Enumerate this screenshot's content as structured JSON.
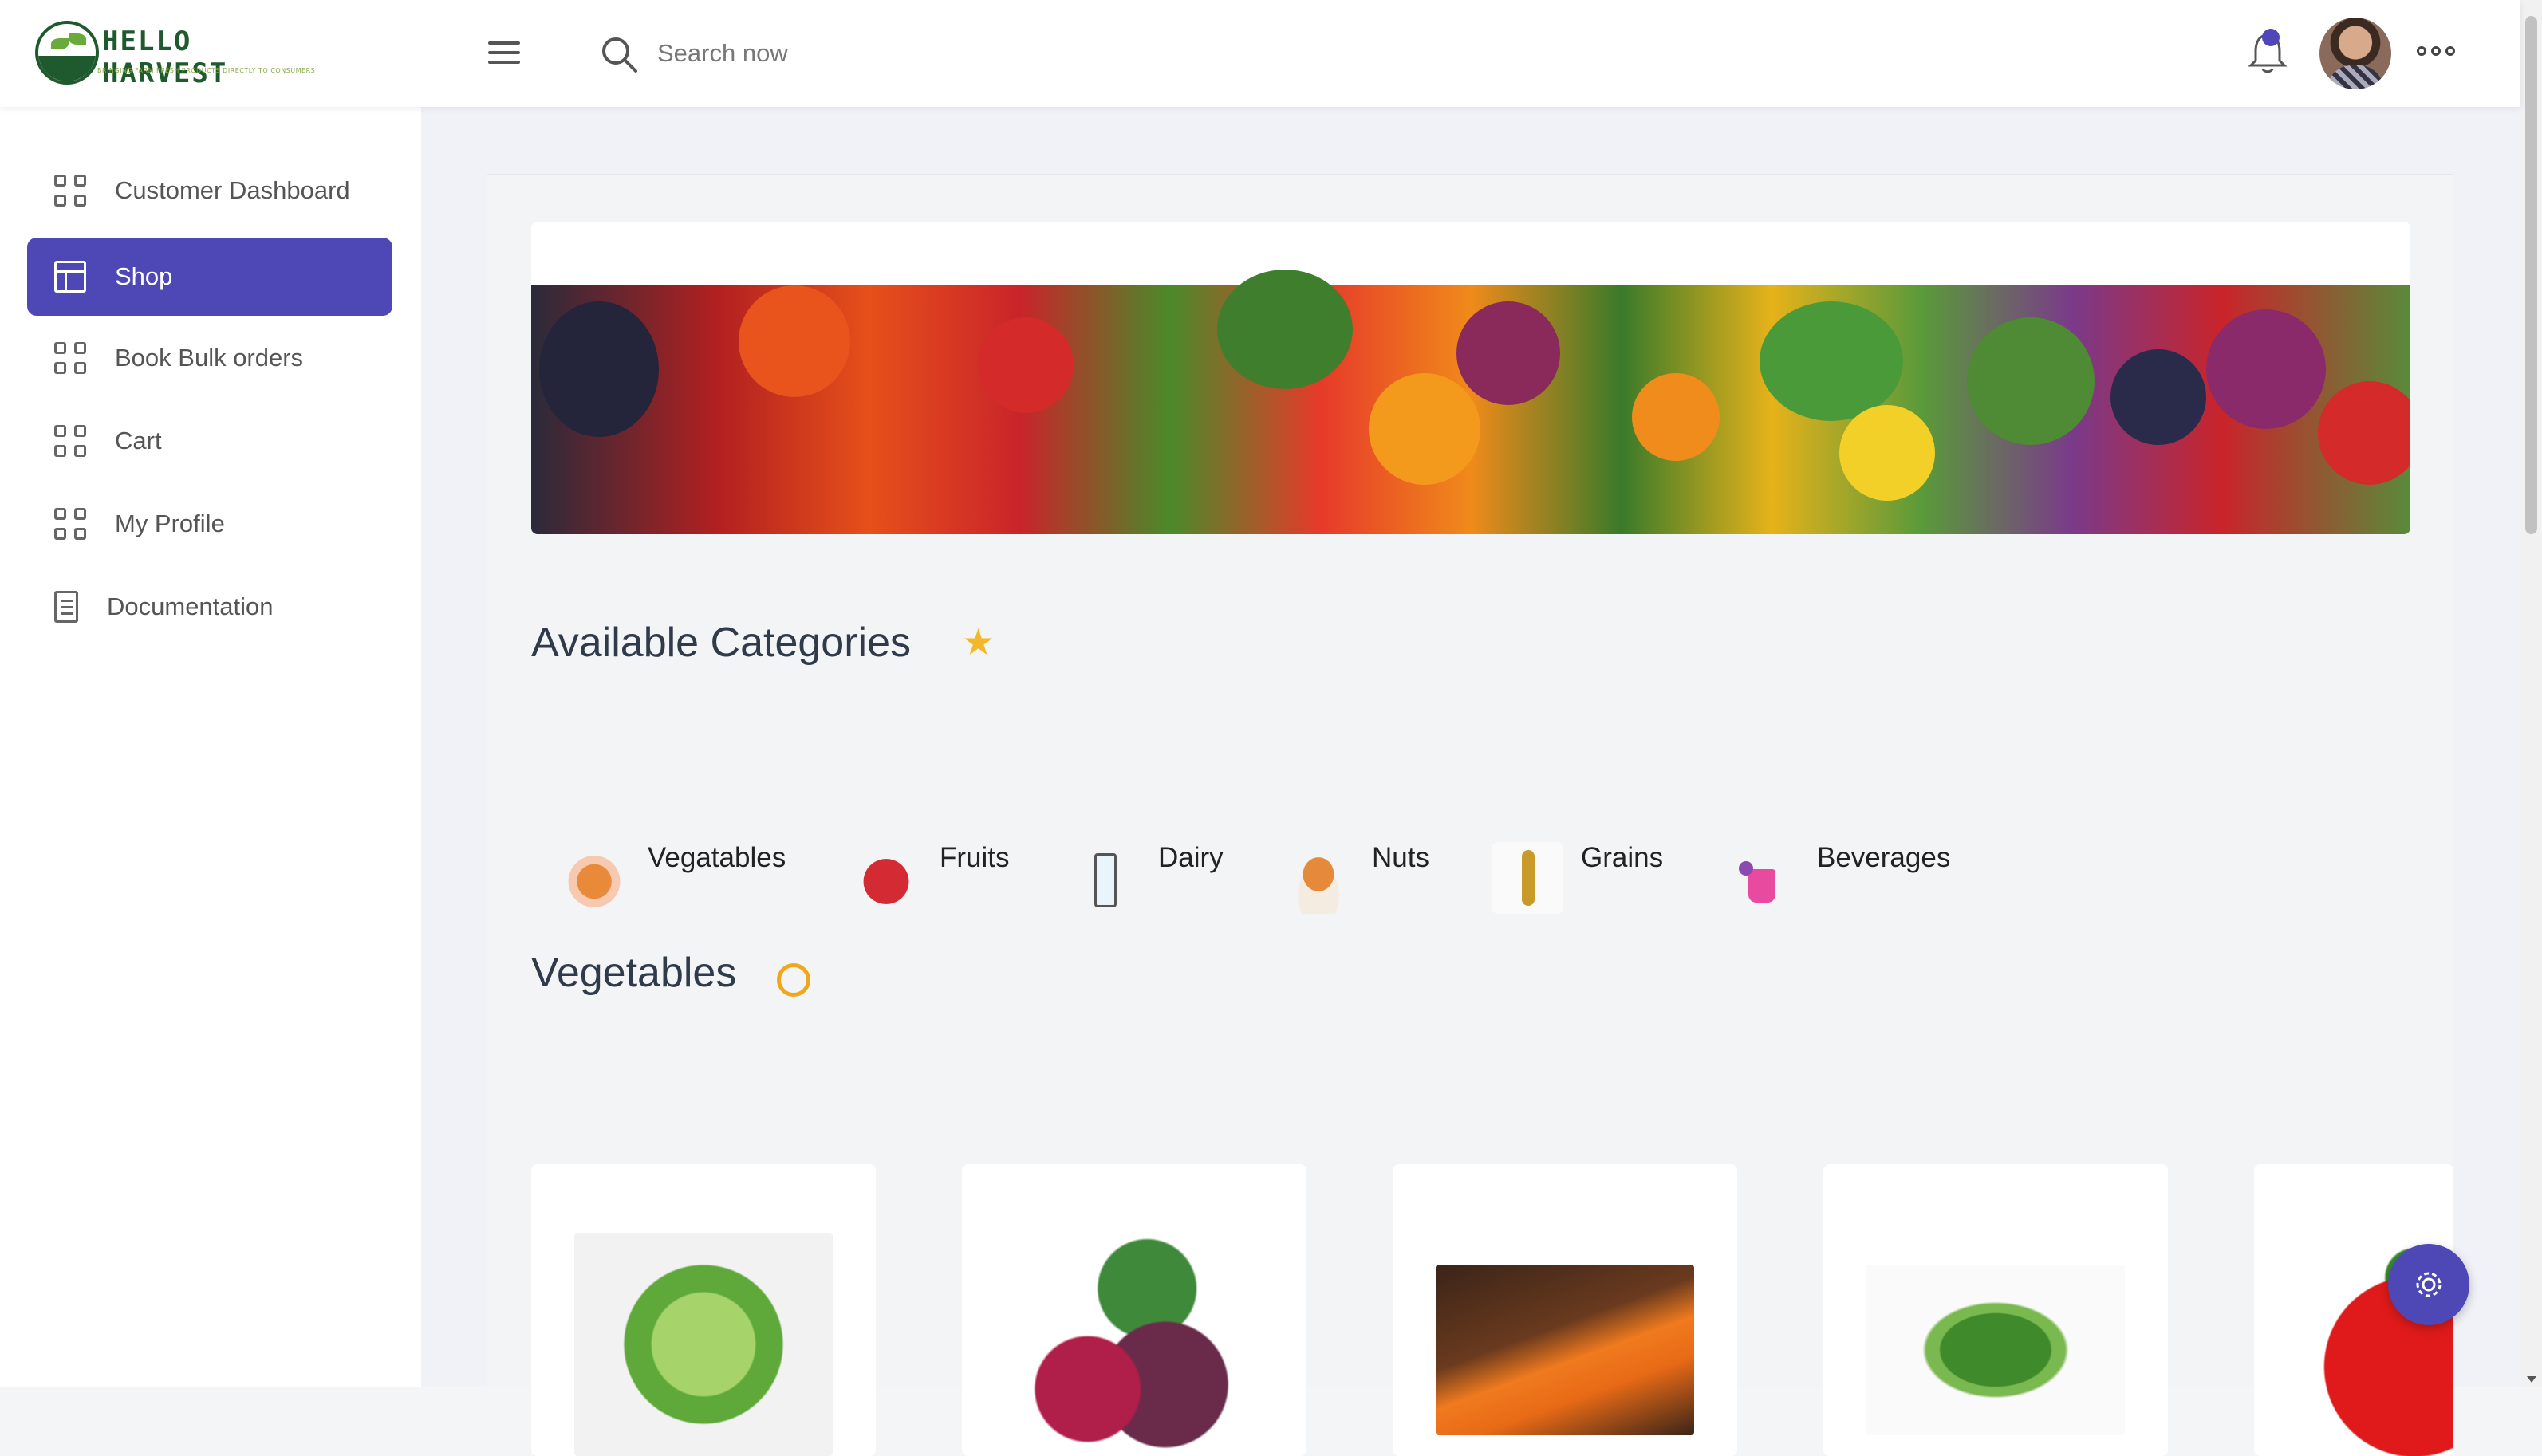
{
  "header": {
    "brand": "HELLO HARVEST",
    "tagline": "BRINGING FARM FRESH PRODUCTS DIRECTLY TO CONSUMERS",
    "search_placeholder": "Search now",
    "icons": [
      "menu-icon",
      "search-icon",
      "bell-icon",
      "avatar",
      "more-icon"
    ]
  },
  "sidebar": {
    "items": [
      {
        "label": "Customer Dashboard",
        "icon": "grid-icon",
        "active": false
      },
      {
        "label": "Shop",
        "icon": "shop-icon",
        "active": true
      },
      {
        "label": "Book Bulk orders",
        "icon": "grid-icon",
        "active": false
      },
      {
        "label": "Cart",
        "icon": "grid-icon",
        "active": false
      },
      {
        "label": "My Profile",
        "icon": "grid-icon",
        "active": false
      },
      {
        "label": "Documentation",
        "icon": "document-icon",
        "active": false
      }
    ]
  },
  "main": {
    "categories_title": "Available Categories",
    "categories": [
      {
        "label": "Vegatables",
        "icon": "vegetable-bag-icon"
      },
      {
        "label": "Fruits",
        "icon": "apple-icon"
      },
      {
        "label": "Dairy",
        "icon": "milk-icon"
      },
      {
        "label": "Nuts",
        "icon": "nuts-bowl-icon"
      },
      {
        "label": "Grains",
        "icon": "wheat-icon"
      },
      {
        "label": "Beverages",
        "icon": "drink-icon"
      }
    ],
    "vegetables_title": "Vegetables",
    "products": [
      {
        "name": "cabbage"
      },
      {
        "name": "beetroot"
      },
      {
        "name": "carrots"
      },
      {
        "name": "green beans"
      },
      {
        "name": "tomato"
      }
    ]
  },
  "colors": {
    "accent": "#4d48b6",
    "brand_green": "#1f5a2e",
    "star": "#f4b728"
  }
}
